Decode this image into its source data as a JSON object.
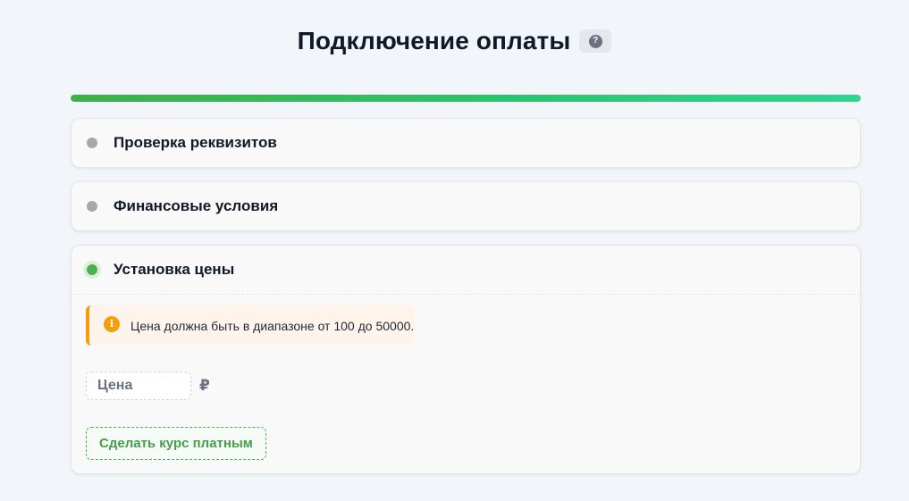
{
  "header": {
    "title": "Подключение оплаты",
    "help_label": "?"
  },
  "progress": {
    "value_percent": 100,
    "color_start": "#3fae4b",
    "color_end": "#33d28f"
  },
  "steps": [
    {
      "title": "Проверка реквизитов",
      "status": "inactive"
    },
    {
      "title": "Финансовые условия",
      "status": "inactive"
    },
    {
      "title": "Установка цены",
      "status": "active"
    }
  ],
  "price_step": {
    "alert": {
      "icon": "info-icon",
      "icon_glyph": "i",
      "text": "Цена должна быть в диапазоне от 100 до 50000."
    },
    "price_input": {
      "placeholder": "Цена",
      "value": ""
    },
    "currency_symbol": "₽",
    "submit_label": "Сделать курс платным"
  },
  "colors": {
    "accent_green": "#4caf50",
    "warning_orange": "#f59e0b",
    "inactive_gray": "#a8a8a8"
  }
}
